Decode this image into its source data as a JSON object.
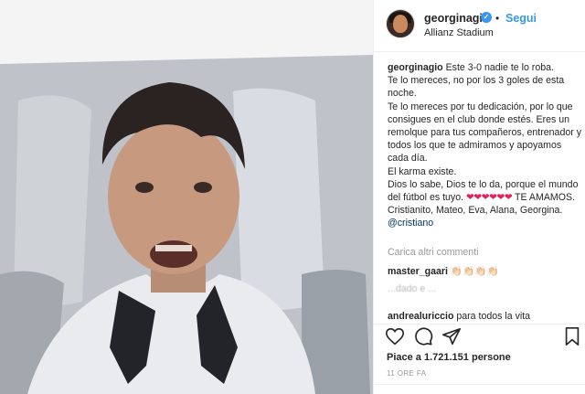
{
  "post": {
    "username": "georginagio",
    "follow_label": "Segui",
    "separator": "•",
    "location": "Allianz Stadium"
  },
  "caption": {
    "username": "georginagio",
    "line1": "Este 3-0 nadie te lo roba.",
    "line2": "Te lo mereces, no por los 3 goles de esta noche.",
    "line3": "Te lo mereces por tu dedicación, por lo que consigues en el club donde estés. Eres un remolque para tus compañeros, entrenador y todos los que te admiramos y apoyamos cada día.",
    "line4": "El karma existe.",
    "line5": "Dios lo sabe, Dios te lo da, porque el mundo del fútbol es tuyo.",
    "hearts": "❤❤❤❤❤❤",
    "line6": "TE AMAMOS. Cristianito, Mateo, Eva, Alana, Georgina.",
    "mention": "@cristiano"
  },
  "comments": {
    "load_more": "Carica altri commenti",
    "items": [
      {
        "username": "master_gaari",
        "text": "👏🏻👏🏻👏🏻👏🏻"
      },
      {
        "username": "",
        "text": "...dado e ..."
      },
      {
        "username": "andrealuriccio",
        "text": "para todos la vita"
      }
    ]
  },
  "actions": {
    "like_icon": "heart-icon",
    "comment_icon": "comment-icon",
    "share_icon": "share-icon",
    "save_icon": "bookmark-icon"
  },
  "stats": {
    "likes": "Piace a 1.721.151 persone",
    "time": "11 ORE FA"
  },
  "colors": {
    "accent": "#3897f0",
    "hearts": "#e0245e",
    "mention": "#003569",
    "muted": "#999999"
  }
}
